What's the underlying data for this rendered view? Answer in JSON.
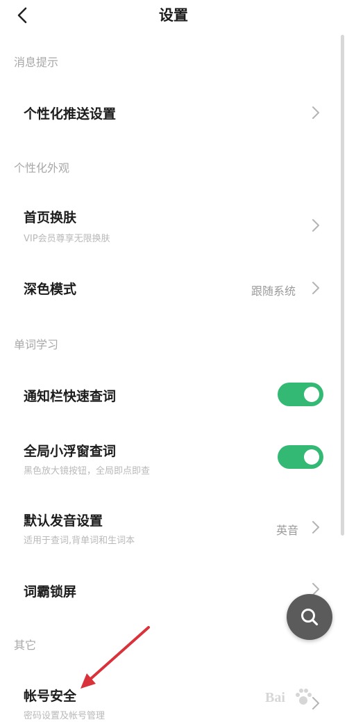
{
  "header": {
    "title": "设置"
  },
  "sections": {
    "notifications": "消息提示",
    "appearance": "个性化外观",
    "word_study": "单词学习",
    "other": "其它"
  },
  "rows": {
    "push": {
      "label": "个性化推送设置"
    },
    "skin": {
      "label": "首页换肤",
      "sub": "VIP会员尊享无限换肤"
    },
    "dark_mode": {
      "label": "深色模式",
      "value": "跟随系统"
    },
    "notify_lookup": {
      "label": "通知栏快速查词",
      "toggle": true
    },
    "float_lookup": {
      "label": "全局小浮窗查词",
      "sub": "黑色放大镜按钮，全局即点即查",
      "toggle": true
    },
    "pronunciation": {
      "label": "默认发音设置",
      "sub": "适用于查词,背单词和生词本",
      "value": "英音"
    },
    "lockscreen": {
      "label": "词霸锁屏"
    },
    "account": {
      "label": "帐号安全",
      "sub": "密码设置及帐号管理"
    }
  },
  "colors": {
    "toggle_on": "#33b974",
    "annotation_arrow": "#d9323a"
  },
  "icons": [
    "back-arrow-icon",
    "chevron-right-icon",
    "search-icon"
  ]
}
